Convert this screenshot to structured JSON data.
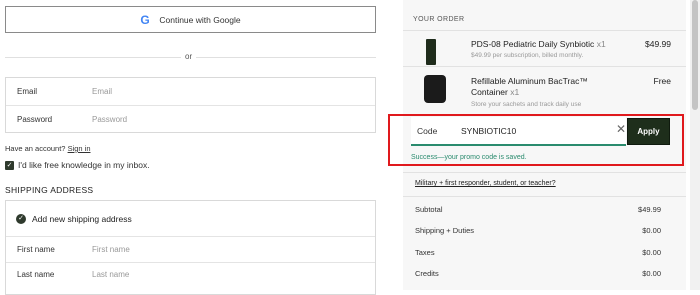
{
  "auth": {
    "google_label": "Continue with Google",
    "google_icon": "google-icon",
    "or_text": "or"
  },
  "login": {
    "email_label": "Email",
    "email_placeholder": "Email",
    "password_label": "Password",
    "password_placeholder": "Password"
  },
  "account": {
    "prompt": "Have an account?",
    "signin_label": "Sign in"
  },
  "newsletter": {
    "checked": true,
    "label": "I'd like free knowledge in my inbox."
  },
  "shipping": {
    "heading": "SHIPPING ADDRESS",
    "add_new_label": "Add new shipping address",
    "first_name_label": "First name",
    "first_name_placeholder": "First name",
    "last_name_label": "Last name",
    "last_name_placeholder": "Last name"
  },
  "order": {
    "heading": "YOUR ORDER",
    "items": [
      {
        "name": "PDS-08 Pediatric Daily Synbiotic",
        "qty": "x1",
        "subtitle": "$49.99 per subscription, billed monthly.",
        "price": "$49.99"
      },
      {
        "name": "Refillable Aluminum BacTrac™ Container",
        "name_line1": "Refillable Aluminum BacTrac™",
        "name_line2": "Container",
        "qty": "x1",
        "subtitle": "Store your sachets and track daily use",
        "price": "Free"
      }
    ]
  },
  "promo": {
    "label": "Code",
    "value": "SYNBIOTIC10",
    "apply_label": "Apply",
    "success_message": "Success—your promo code is saved."
  },
  "military_link": "Military + first responder, student, or teacher?",
  "summary": [
    {
      "label": "Subtotal",
      "value": "$49.99"
    },
    {
      "label": "Shipping + Duties",
      "value": "$0.00"
    },
    {
      "label": "Taxes",
      "value": "$0.00"
    },
    {
      "label": "Credits",
      "value": "$0.00"
    }
  ],
  "colors": {
    "accent_dark_green": "#1e2e1b",
    "success_green": "#2a8b6e",
    "highlight_red": "#e0191d"
  }
}
